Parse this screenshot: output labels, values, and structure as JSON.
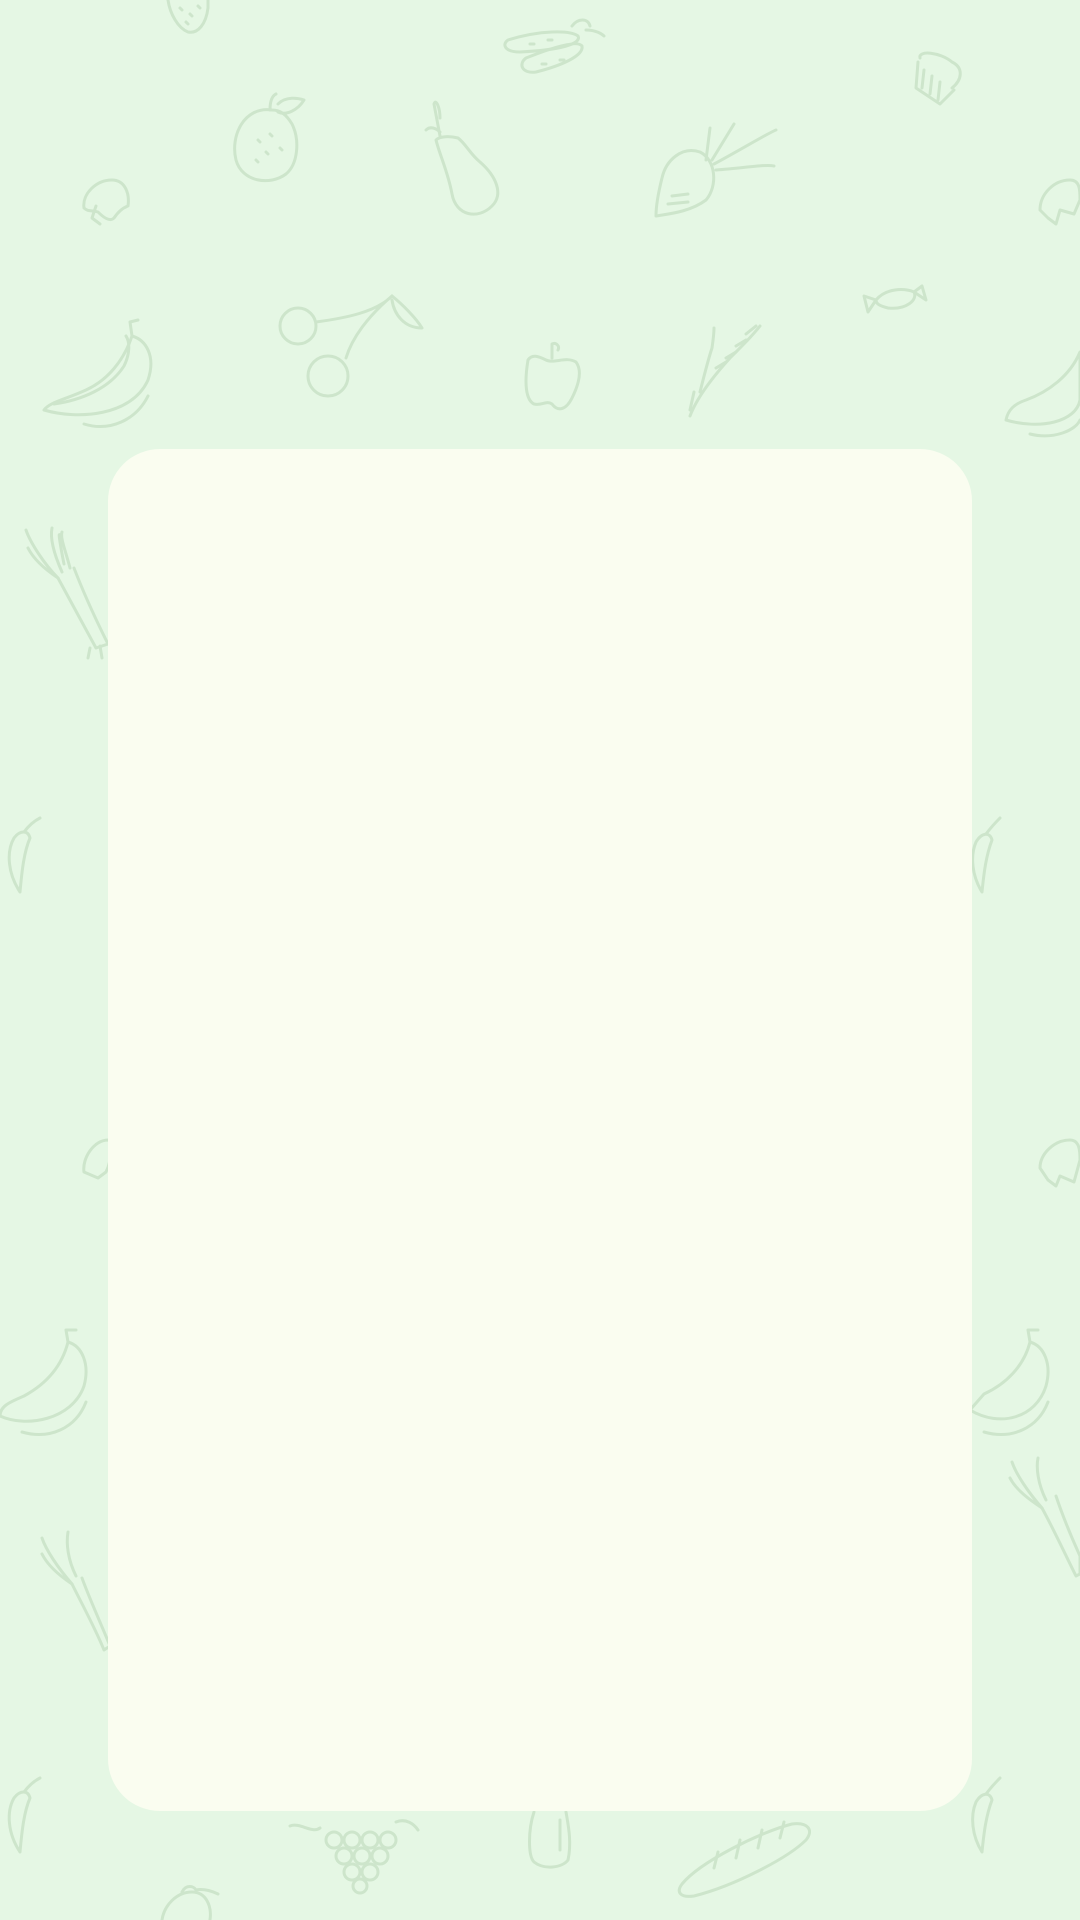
{
  "screen": {
    "background_color": "#e5f7e4",
    "pattern_color": "#cde5cb",
    "card_color": "#fafdf0"
  },
  "background_pattern": {
    "icons": [
      "strawberry-icon",
      "cucumber-icon",
      "cupcake-icon",
      "orange-icon",
      "pear-icon",
      "beet-icon",
      "mushroom-icon",
      "banana-icon",
      "cherry-icon",
      "pepper-icon",
      "wheat-icon",
      "candy-icon",
      "leek-icon",
      "chili-icon",
      "grapes-icon",
      "eggplant-icon",
      "baguette-icon"
    ]
  },
  "content_card": {
    "state": "empty"
  }
}
